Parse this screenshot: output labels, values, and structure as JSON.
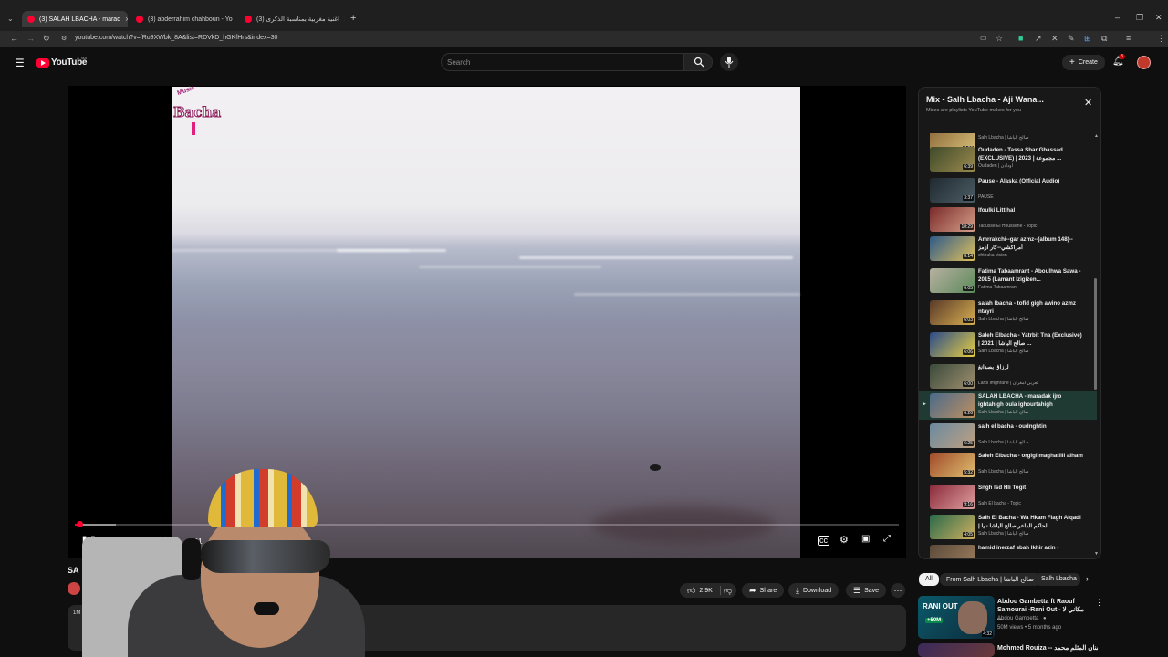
{
  "browser": {
    "tabs": [
      {
        "label": "(3) SALAH LBACHA - marad"
      },
      {
        "label": "(3) abderrahim chahboun - Yo"
      },
      {
        "label": "(3) اغنية مغربية بمناسبة الذكرى"
      }
    ],
    "new_tab": "+",
    "url": "youtube.com/watch?v=fRo9XWbk_8A&list=RDVkD_hGKfHrs&index=30"
  },
  "youtube": {
    "logo_text": "YouTube",
    "logo_suffix": "MA",
    "search_placeholder": "Search",
    "create_label": "Create",
    "notification_count": "3"
  },
  "player": {
    "channel_watermark": "Bacha",
    "time_current": "0:01",
    "progress_fraction": 0.005,
    "buffered_fraction": 0.05
  },
  "video_info": {
    "title_visible_start": "SA",
    "title_visible_end": "igh",
    "like_count": "2.9K",
    "share_label": "Share",
    "download_label": "Download",
    "save_label": "Save",
    "desc_start": "1M"
  },
  "playlist": {
    "title": "Mix - Salh Lbacha - Aji Wana...",
    "subtitle": "Mixes are playlists YouTube makes for you",
    "items": [
      {
        "title": "",
        "channel": "Salh Lbacha | صالح الباشا",
        "duration": "7:26",
        "thumb": [
          "#8c6a3a",
          "#d8c07a"
        ]
      },
      {
        "title": "Oudaden - Tassa Sbar Ghassad (EXCLUSIVE) | 2023 | مجموعة ...",
        "channel": "Oudaden | أودادن",
        "duration": "6:39",
        "thumb": [
          "#3f4a2a",
          "#9b8a4e"
        ]
      },
      {
        "title": "Pause - Alaska (Official Audio)",
        "channel": "PAUSE",
        "duration": "3:37",
        "thumb": [
          "#1f2a30",
          "#4d5d66"
        ]
      },
      {
        "title": "Ifoulki Littihal",
        "channel": "Taousse El Houssene - Topic",
        "duration": "10:29",
        "thumb": [
          "#7a2a2a",
          "#d6a08a"
        ]
      },
      {
        "title": "Amrrakchi--gar azmz--(album 148)--أمراكشي--كار أزمز",
        "channel": "chtouka vision",
        "duration": "8:14",
        "thumb": [
          "#2e5a8a",
          "#e0c05a"
        ]
      },
      {
        "title": "Fatima Tabaamrant - Aboulhwa Sawa - 2015 (Lamant Izigizen...",
        "channel": "Fatima Tabaamrant",
        "duration": "6:05",
        "thumb": [
          "#b8b0a0",
          "#5a8a5a"
        ]
      },
      {
        "title": "salah lbacha - tofid gigh awino azmz ntayri",
        "channel": "Salh Lbacha | صالح الباشا",
        "duration": "6:03",
        "thumb": [
          "#5a3a2a",
          "#d8b050"
        ]
      },
      {
        "title": "Saleh Elbacha - Yatrbit Tna (Exclusive) | 2021 | صالح الباشا ...",
        "channel": "Salh Lbacha | صالح الباشا",
        "duration": "6:06",
        "thumb": [
          "#2a4a8a",
          "#e8d040"
        ]
      },
      {
        "title": "لرزاق بصدانغ",
        "channel": "Larbi Imghrane | لعربي امغران",
        "duration": "6:00",
        "thumb": [
          "#3a4a3a",
          "#a09070"
        ]
      },
      {
        "title": "SALAH LBACHA - maradak ijro ightahigh oula ighourtahigh",
        "channel": "Salh Lbacha | صالح الباشا",
        "duration": "6:26",
        "thumb": [
          "#4a6a8a",
          "#c09060"
        ]
      },
      {
        "title": "salh el bacha - oudnghtin",
        "channel": "Salh Lbacha | صالح الباشا",
        "duration": "6:25",
        "thumb": [
          "#6a8aa0",
          "#c0a080"
        ]
      },
      {
        "title": "Saleh Elbacha - orgigi maghatiili alham",
        "channel": "Salh Lbacha | صالح الباشا",
        "duration": "5:32",
        "thumb": [
          "#a04a2a",
          "#e0c070"
        ]
      },
      {
        "title": "Sngh Isd Hli Togit",
        "channel": "Salh El bacha - Topic",
        "duration": "9:16",
        "thumb": [
          "#8a2a3a",
          "#e0a0a0"
        ]
      },
      {
        "title": "Salh El Bacha - Wa Hkam Flagh Alqadi | الحاكم الداعر صالح الباشا - يا ...",
        "channel": "Salh Lbacha | صالح الباشا",
        "duration": "4:05",
        "thumb": [
          "#2a6a4a",
          "#d0b060"
        ]
      },
      {
        "title": "hamid inerzaf sbah lkhir azin -",
        "channel": "",
        "duration": "",
        "thumb": [
          "#5a4a3a",
          "#a08060"
        ]
      }
    ],
    "current_index": 9,
    "current_marker": "▶"
  },
  "chips": [
    {
      "label": "All"
    },
    {
      "label": "From Salh Lbacha | صالح الباشا"
    },
    {
      "label": "Salh Lbacha"
    }
  ],
  "recommendations": [
    {
      "title": "Abdou Gambetta ft Raouf Samourai -Rani Out - مكاني لا ...",
      "channel": "Abdou Gambetta",
      "meta": "50M views • 5 months ago",
      "duration": "4:32",
      "badge": "+50M",
      "thumb_text": "RANI OUT"
    },
    {
      "title": "Mohmed Rouiza -- الفنان المثلم محمد",
      "channel": "",
      "meta": "",
      "duration": "",
      "badge": "",
      "thumb_text": ""
    }
  ],
  "colors": {
    "accent": "#ff0033",
    "current_row": "#1f3a33",
    "surface": "#272727"
  },
  "icons": [
    "menu-icon",
    "search-icon",
    "mic-icon",
    "bell-icon",
    "close-icon",
    "kebab-icon",
    "like-icon",
    "dislike-icon",
    "share-icon",
    "download-icon",
    "save-icon",
    "pause-icon",
    "volume-icon",
    "subtitles-icon",
    "settings-icon",
    "miniplayer-icon",
    "fullscreen-icon"
  ]
}
